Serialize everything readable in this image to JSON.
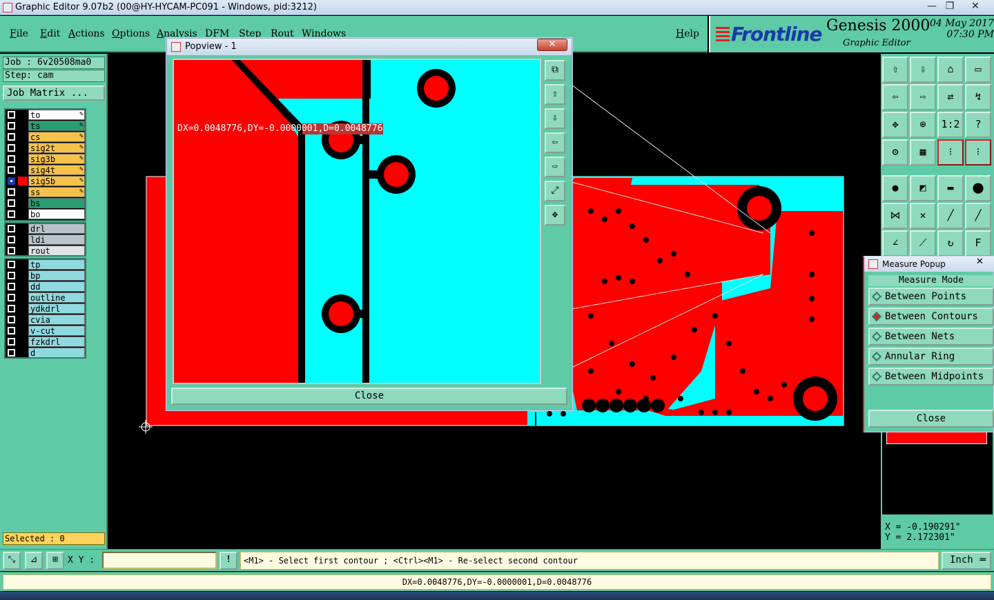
{
  "window": {
    "title": "Graphic Editor 9.07b2 (00@HY-HYCAM-PC091 - Windows, pid:3212)",
    "minimize": "—",
    "restore": "❐",
    "close": "✕"
  },
  "menu": {
    "items": [
      "File",
      "Edit",
      "Actions",
      "Options",
      "Analysis",
      "DFM",
      "Step",
      "Rout",
      "Windows"
    ],
    "help": "Help"
  },
  "brand": {
    "logo": "Frontline",
    "product": "Genesis 2000",
    "subtitle": "Graphic Editor",
    "date": "04 May 2017",
    "time": "07:30 PM"
  },
  "job": {
    "job_label": "Job  :  6v20508ma0",
    "step_label": "Step: cam",
    "matrix_button": "Job Matrix ..."
  },
  "layers": {
    "group1": [
      {
        "name": "to",
        "color": "#ffffff",
        "active": false,
        "editable": true
      },
      {
        "name": "ts",
        "color": "#2a9d72",
        "active": false,
        "editable": true
      },
      {
        "name": "cs",
        "color": "#f6c24a",
        "active": false,
        "editable": true
      },
      {
        "name": "sig2t",
        "color": "#f6c24a",
        "active": false,
        "editable": true
      },
      {
        "name": "sig3b",
        "color": "#f6c24a",
        "active": false,
        "editable": true
      },
      {
        "name": "sig4t",
        "color": "#f6c24a",
        "active": false,
        "editable": true
      },
      {
        "name": "sig5b",
        "color": "#f6c24a",
        "active": true,
        "editable": true
      },
      {
        "name": "ss",
        "color": "#f6c24a",
        "active": false,
        "editable": true
      },
      {
        "name": "bs",
        "color": "#2a9d72",
        "active": false,
        "editable": false
      },
      {
        "name": "bo",
        "color": "#ffffff",
        "active": false,
        "editable": false
      }
    ],
    "group2": [
      {
        "name": "drl",
        "color": "#b8c4cc"
      },
      {
        "name": "ldi",
        "color": "#b8c4cc"
      },
      {
        "name": "rout",
        "color": "#dfe3e6"
      }
    ],
    "group3": [
      {
        "name": "tp",
        "color": "#8fd9e0"
      },
      {
        "name": "bp",
        "color": "#8fd9e0"
      },
      {
        "name": "dd",
        "color": "#8fd9e0"
      },
      {
        "name": "outline",
        "color": "#8fd9e0"
      },
      {
        "name": "ydkdrl",
        "color": "#8fd9e0"
      },
      {
        "name": "cvia",
        "color": "#8fd9e0"
      },
      {
        "name": "v-cut",
        "color": "#8fd9e0"
      },
      {
        "name": "fzkdrl",
        "color": "#8fd9e0"
      },
      {
        "name": "d",
        "color": "#8fd9e0"
      }
    ],
    "selected": "Selected : 0"
  },
  "popview": {
    "title": "Popview - 1",
    "measurement": "DX=0.0048776,DY=-0.0000001,D=0.0048776",
    "close_label": "Close"
  },
  "measure_popup": {
    "title": "Measure Popup",
    "mode_label": "Measure Mode",
    "options": [
      "Between Points",
      "Between Contours",
      "Between Nets",
      "Annular Ring",
      "Between Midpoints"
    ],
    "selected_option": "Between Contours",
    "close_label": "Close"
  },
  "coords": {
    "x": "X = -0.190291\"",
    "y": "Y =  2.172301\""
  },
  "command": {
    "xy_label": "X Y :",
    "xy_value": "",
    "prompt": "<M1> - Select first contour ; <Ctrl><M1> - Re-select second contour",
    "unit": "Inch"
  },
  "status": {
    "text": "DX=0.0048776,DY=-0.0000001,D=0.0048776"
  },
  "colors": {
    "panel": "#5fcaa6",
    "copper": "#ff0000",
    "substrate": "#00ffff",
    "background": "#000000"
  },
  "toolbar_icons": [
    "zoom-home-icon",
    "zoom-fit-icon",
    "home-icon",
    "window-icon",
    "zoom-in-icon",
    "zoom-out-icon",
    "mirror-icon",
    "redraw-icon",
    "pan-icon",
    "center-icon",
    "scale-icon",
    "help-icon",
    "settings-icon",
    "grid-icon",
    "snap-icon",
    "layers-icon",
    "point-icon",
    "shape-icon",
    "ruler-icon",
    "dot-icon",
    "nodes-icon",
    "cross-icon",
    "line-icon",
    "arc-icon",
    "angle-icon",
    "measure-icon",
    "rotate-icon",
    "text-icon"
  ]
}
